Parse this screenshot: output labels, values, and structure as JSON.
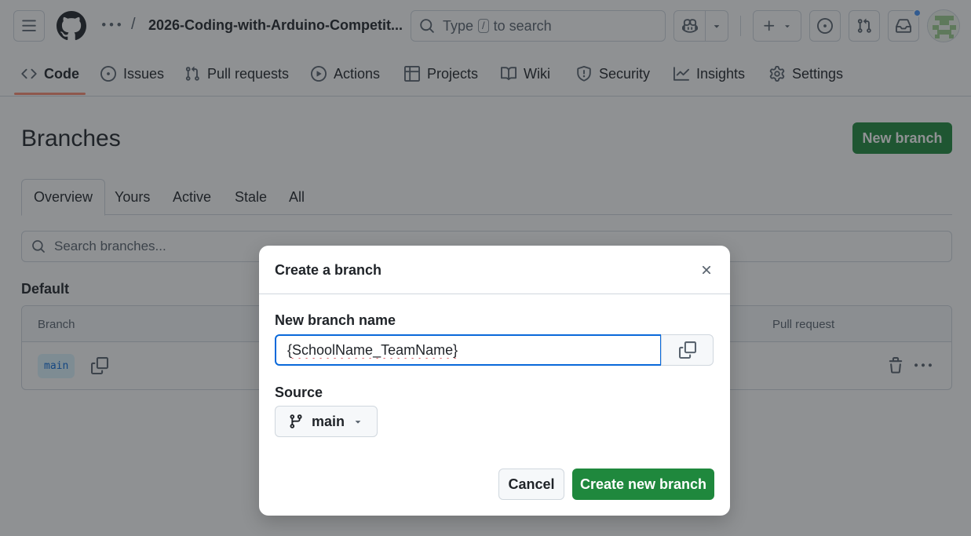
{
  "header": {
    "repo_name": "2026-Coding-with-Arduino-Competit...",
    "breadcrumb_separator": "/",
    "search_pre": "Type",
    "search_key": "/",
    "search_post": "to search",
    "icons": [
      "menu-icon",
      "github-logo",
      "kebab-icon",
      "search-icon",
      "copilot-icon",
      "caret-down-icon",
      "plus-icon",
      "issue-opened-icon",
      "pull-request-icon",
      "inbox-icon",
      "avatar"
    ],
    "notification_color": "#4493f8"
  },
  "repo_nav": {
    "items": [
      {
        "label": "Code",
        "icon": "code-icon"
      },
      {
        "label": "Issues",
        "icon": "issue-opened-icon"
      },
      {
        "label": "Pull requests",
        "icon": "pull-request-icon"
      },
      {
        "label": "Actions",
        "icon": "play-icon"
      },
      {
        "label": "Projects",
        "icon": "table-icon"
      },
      {
        "label": "Wiki",
        "icon": "book-icon"
      },
      {
        "label": "Security",
        "icon": "shield-icon"
      },
      {
        "label": "Insights",
        "icon": "graph-icon"
      },
      {
        "label": "Settings",
        "icon": "gear-icon"
      }
    ],
    "active": "Code",
    "underline_color": "#fd8c73"
  },
  "page": {
    "title": "Branches",
    "new_branch_label": "New branch",
    "tabs": [
      "Overview",
      "Yours",
      "Active",
      "Stale",
      "All"
    ],
    "active_tab": "Overview",
    "search_placeholder": "Search branches...",
    "section_label": "Default",
    "table": {
      "columns": [
        "Branch",
        "Pull request"
      ],
      "rows": [
        {
          "branch": "main"
        }
      ]
    }
  },
  "dialog": {
    "title": "Create a branch",
    "name_label": "New branch name",
    "name_value": "{SchoolName_TeamName}",
    "source_label": "Source",
    "source_value": "main",
    "cancel_label": "Cancel",
    "create_label": "Create new branch"
  },
  "colors": {
    "primary_green": "#1f883d",
    "focus_blue": "#0969da",
    "branch_chip_bg": "#ddf4ff"
  }
}
